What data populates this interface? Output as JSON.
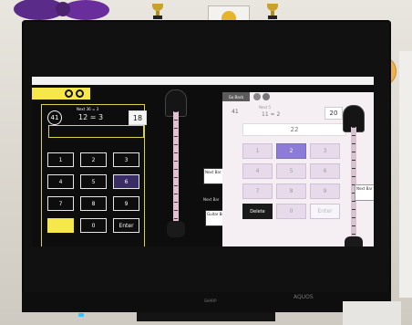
{
  "left_app": {
    "level": "41",
    "next_line": "Next 36 = 3",
    "question": "12 = 3",
    "score": "18",
    "keypad": [
      "1",
      "2",
      "3",
      "4",
      "5",
      "6",
      "7",
      "8",
      "9",
      "",
      "0",
      "Enter"
    ]
  },
  "middle": {
    "note_top": "Next Bar",
    "note_bottom": "Guitar Book",
    "bottom_text": "Next Bar"
  },
  "right_app": {
    "back_label": "Go Back",
    "level": "41",
    "next_line": "Next 5",
    "question": "11 = 2",
    "score": "20",
    "answer": "22",
    "keypad": [
      "1",
      "2",
      "3",
      "4",
      "5",
      "6",
      "7",
      "8",
      "9",
      "Delete",
      "0",
      "Enter"
    ],
    "note": "Next Bar"
  },
  "tv": {
    "brand": "SHARP",
    "label": "AQUOS"
  }
}
